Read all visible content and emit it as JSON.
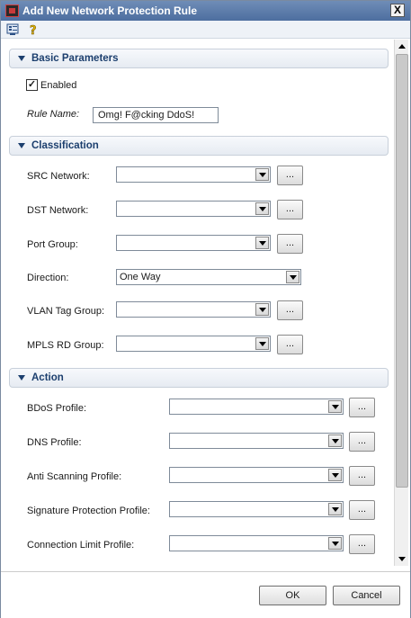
{
  "window": {
    "title": "Add New Network Protection Rule",
    "close_label": "X"
  },
  "toolbar": {
    "icon1": "properties-icon",
    "icon2": "help-icon"
  },
  "basic": {
    "header": "Basic Parameters",
    "enabled_label": "Enabled",
    "enabled_check": "✓",
    "rule_name_label": "Rule Name:",
    "rule_name_value": "Omg!  F@cking DdoS!"
  },
  "classification": {
    "header": "Classification",
    "fields": [
      {
        "label": "SRC Network:",
        "value": ""
      },
      {
        "label": "DST Network:",
        "value": ""
      },
      {
        "label": "Port Group:",
        "value": ""
      },
      {
        "label": "Direction:",
        "value": "One Way"
      },
      {
        "label": "VLAN Tag Group:",
        "value": ""
      },
      {
        "label": "MPLS RD Group:",
        "value": ""
      }
    ]
  },
  "action": {
    "header": "Action",
    "fields": [
      {
        "label": "BDoS Profile:",
        "value": ""
      },
      {
        "label": "DNS Profile:",
        "value": ""
      },
      {
        "label": "Anti Scanning Profile:",
        "value": ""
      },
      {
        "label": "Signature Protection Profile:",
        "value": ""
      },
      {
        "label": "Connection Limit Profile:",
        "value": ""
      }
    ]
  },
  "ellipsis": "...",
  "footer": {
    "ok_label": "OK",
    "cancel_label": "Cancel"
  }
}
